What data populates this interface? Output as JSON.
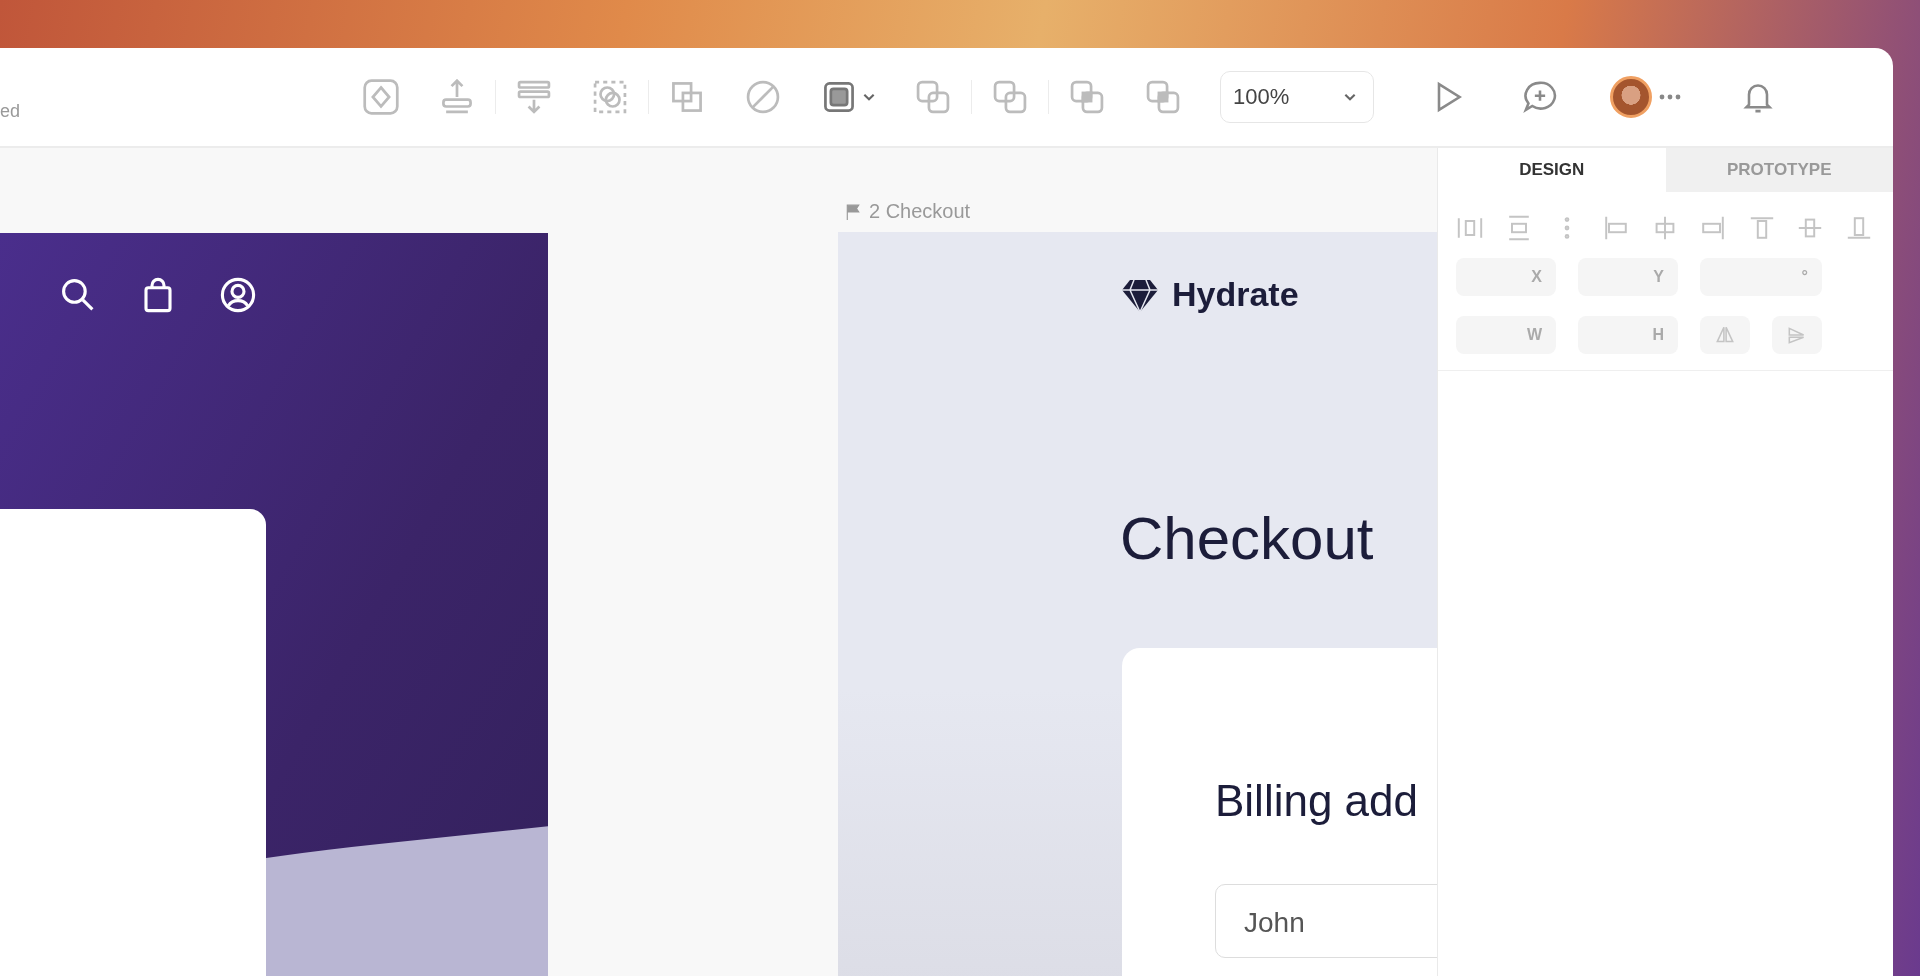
{
  "toolbar": {
    "file_status": "ed",
    "zoom": "100%"
  },
  "panel": {
    "tabs": [
      {
        "label": "DESIGN",
        "selected": true
      },
      {
        "label": "PROTOTYPE",
        "selected": false
      }
    ],
    "fields": [
      {
        "label": "X"
      },
      {
        "label": "Y"
      },
      {
        "label": "°"
      },
      {
        "label": "W"
      },
      {
        "label": "H"
      }
    ]
  },
  "checkout_frame": {
    "label": "2 Checkout",
    "brand": "Hydrate",
    "heading": "Checkout",
    "section_title": "Billing add",
    "first_name": "John"
  }
}
